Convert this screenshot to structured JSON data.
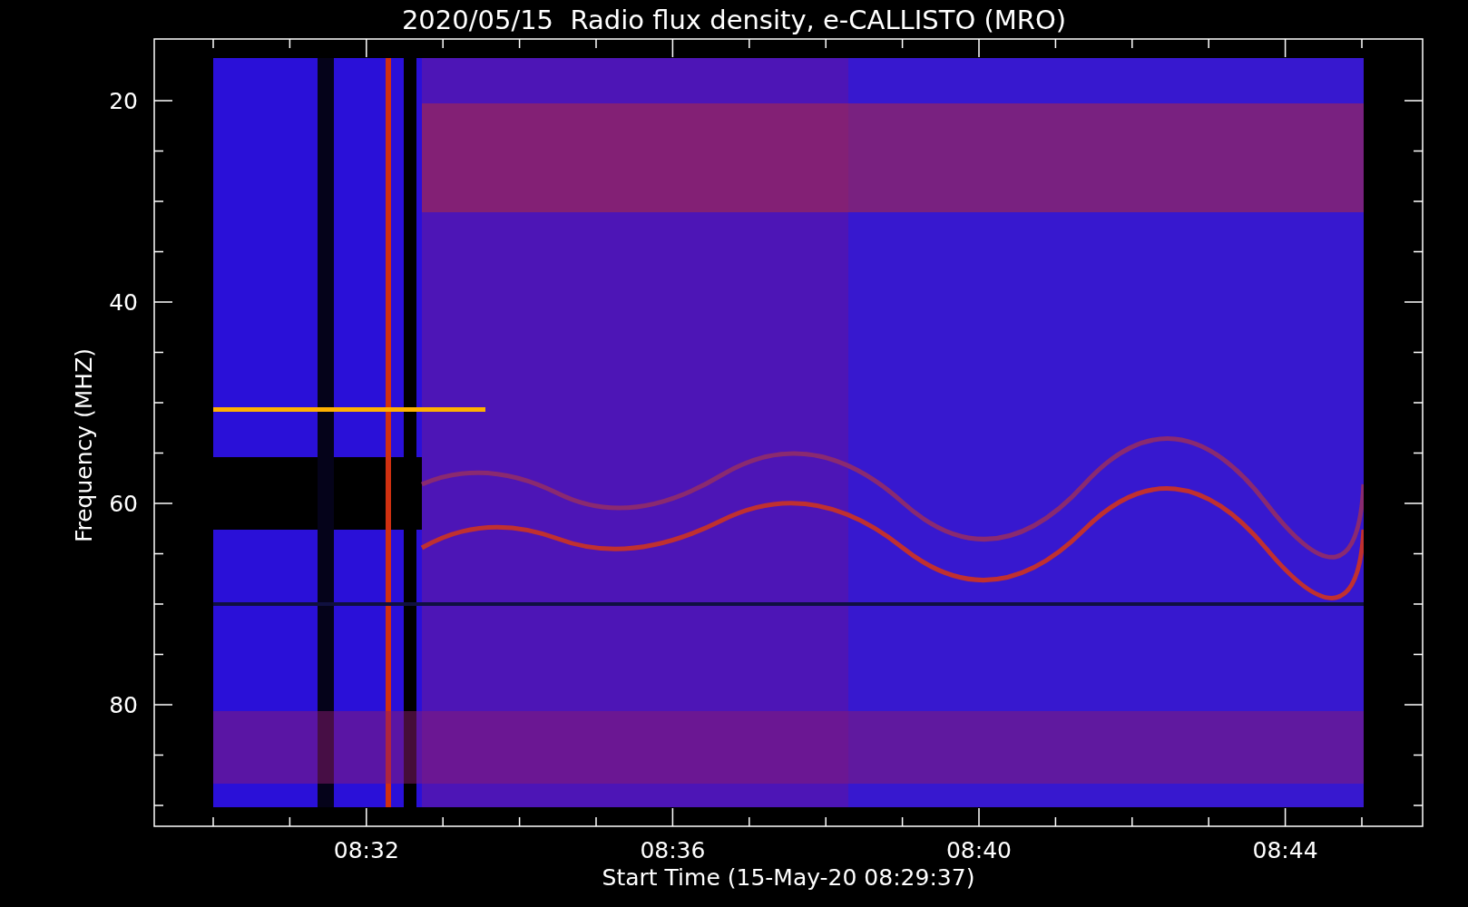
{
  "plot": {
    "title": "2020/05/15  Radio flux density, e-CALLISTO (MRO)",
    "xlabel": "Start Time (15-May-20 08:29:37)",
    "ylabel": "Frequency (MHZ)",
    "xtick_labels": [
      "08:32",
      "08:36",
      "08:40",
      "08:44"
    ],
    "ytick_labels": [
      "20",
      "40",
      "60",
      "80"
    ]
  }
}
